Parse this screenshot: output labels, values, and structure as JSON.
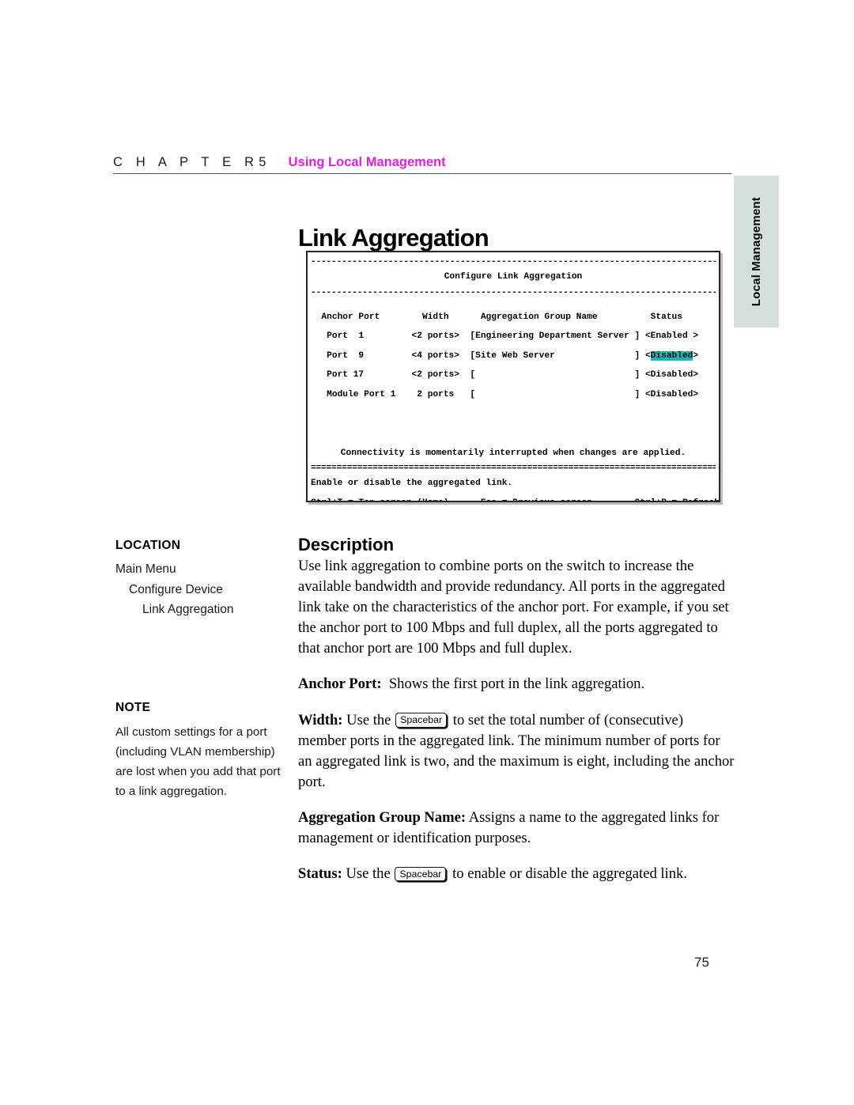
{
  "header": {
    "chapter_word": "C H A P T E R",
    "chapter_number": "5",
    "chapter_title": "Using Local Management",
    "title_color": "#e020e0"
  },
  "side_tab": {
    "label": "Local Management",
    "background": "#d5e0dd"
  },
  "section": {
    "title": "Link Aggregation"
  },
  "terminal": {
    "screen_title": "Configure Link Aggregation",
    "rule_dashed": "-------------------------------------------------------------------------------",
    "rule_double": "===============================================================================",
    "columns": {
      "anchor_port": "Anchor Port",
      "width": "Width",
      "group_name": "Aggregation Group Name",
      "status": "Status"
    },
    "header_row": "  Anchor Port        Width      Aggregation Group Name          Status",
    "rows": [
      {
        "line": "   Port  1         <2 ports>  [Engineering Department Server ] ",
        "status_text": "<Enabled >",
        "anchor_port": "Port  1",
        "width": "<2 ports>",
        "group_name": "[Engineering Department Server ]",
        "status": "<Enabled >",
        "highlighted": false
      },
      {
        "line": "   Port  9         <4 ports>  [Site Web Server               ] ",
        "status_prefix": "<",
        "status_value": "Disabled",
        "status_suffix": ">",
        "anchor_port": "Port  9",
        "width": "<4 ports>",
        "group_name": "[Site Web Server               ]",
        "status": "<Disabled>",
        "highlighted": true
      },
      {
        "line": "   Port 17         <2 ports>  [                              ] ",
        "status_text": "<Disabled>",
        "anchor_port": "Port 17",
        "width": "<2 ports>",
        "group_name": "[                              ]",
        "status": "<Disabled>",
        "highlighted": false
      },
      {
        "line": "   Module Port 1    2 ports   [                              ] ",
        "status_text": "<Disabled>",
        "anchor_port": "Module Port 1",
        "width": "2 ports",
        "group_name": "[                              ]",
        "status": "<Disabled>",
        "highlighted": false
      }
    ],
    "notice": "Connectivity is momentarily interrupted when changes are applied.",
    "prompt": "Enable or disable the aggregated link.",
    "keys_line": "Ctrl+T = Top screen (Home)      Esc = Previous screen        Ctrl+R = Refresh",
    "highlight_color": "#1fb5b5"
  },
  "margin": {
    "location_heading": "LOCATION",
    "location_items": [
      "Main Menu",
      "Configure Device",
      "Link Aggregation"
    ],
    "note_heading": "NOTE",
    "note_body": "All custom settings for a port (including VLAN membership) are lost when you add that port to a link aggregation."
  },
  "description": {
    "heading": "Description",
    "intro": "Use link aggregation to combine ports on the switch to increase the available bandwidth and provide redundancy. All ports in the aggregated link take on the characteristics of the anchor port. For example, if you set the anchor port to 100 Mbps and full duplex, all the ports aggregated to that anchor port are 100 Mbps and full duplex.",
    "anchor_port_label": "Anchor Port:",
    "anchor_port_text": "Shows the first port in the link aggregation.",
    "width_label": "Width:",
    "width_text_before": "Use the",
    "width_key": "Spacebar",
    "width_text_after": "to set the total number of (consecutive) member ports in the aggregated link. The minimum number of ports for an aggregated link is two, and the maximum is eight, including the anchor port.",
    "group_name_label": "Aggregation Group Name:",
    "group_name_text": "Assigns a name to the aggregated links for management or identification purposes.",
    "status_label": "Status:",
    "status_text_before": "Use the",
    "status_key": "Spacebar",
    "status_text_after": "to enable or disable the aggregated link."
  },
  "footer": {
    "page_number": "75"
  }
}
